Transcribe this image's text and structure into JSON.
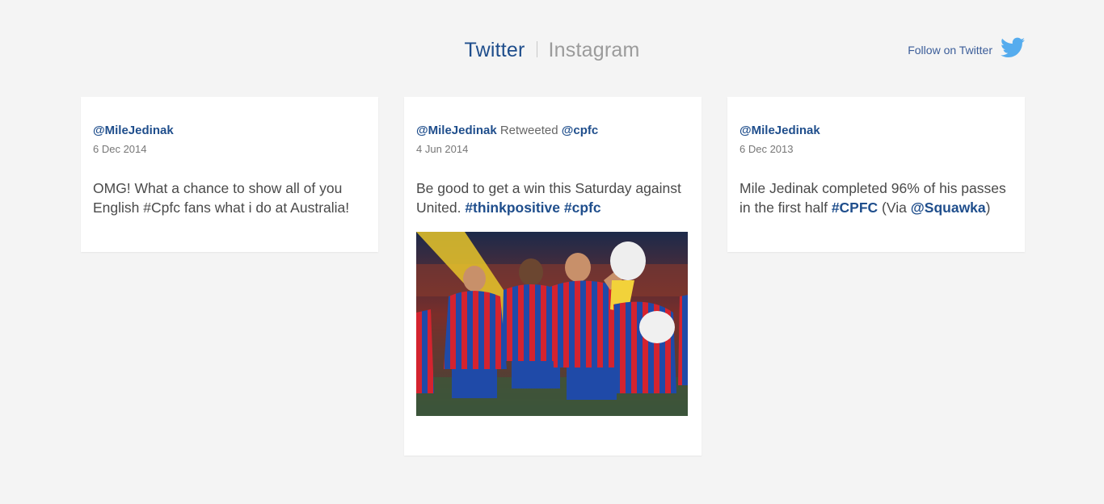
{
  "tabs": {
    "twitter": "Twitter",
    "instagram": "Instagram"
  },
  "follow": {
    "label": "Follow on Twitter",
    "icon": "twitter-bird-icon",
    "icon_color": "#55acee"
  },
  "colors": {
    "accent": "#1f4e8c",
    "background": "#f4f4f4"
  },
  "tweets": [
    {
      "handle": "@MileJedinak",
      "date": "6 Dec 2014",
      "text": "OMG! What a chance to show all of you English #Cpfc fans what i do at Australia!"
    },
    {
      "handle": "@MileJedinak",
      "retweeted_label": "Retweeted",
      "retweeted_handle": "@cpfc",
      "date": "4 Jun 2014",
      "text_before": "Be good to get a win this Saturday against United. ",
      "hashtag_1": "#thinkpositive",
      "hashtag_2": "#cpfc"
    },
    {
      "handle": "@MileJedinak",
      "date": "6 Dec 2013",
      "text_before": "Mile Jedinak completed 96% of his passes in the first half ",
      "hashtag": "#CPFC",
      "via_open": " (Via ",
      "mention": "@Squawka",
      "via_close": ")"
    }
  ]
}
